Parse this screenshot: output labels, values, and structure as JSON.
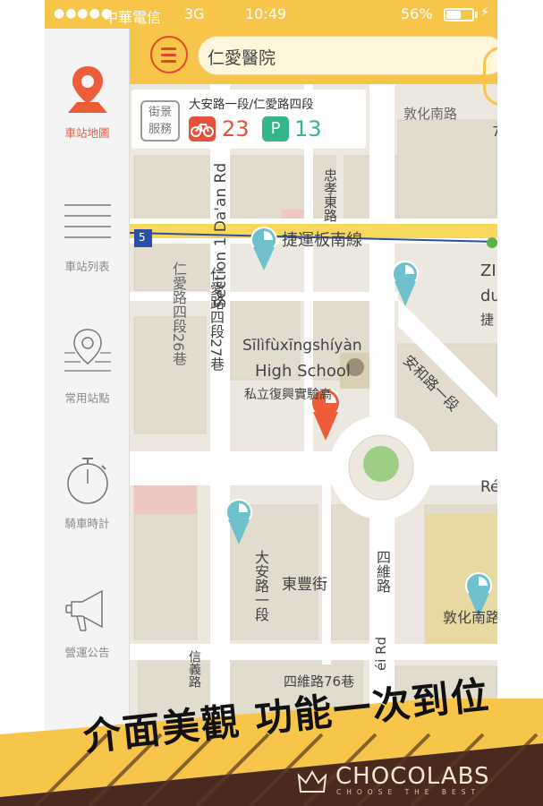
{
  "status_bar": {
    "signal": "●●●●●",
    "carrier": "中華電信",
    "network": "3G",
    "time": "10:49",
    "battery": "56%",
    "battery_level": 0.56
  },
  "search": {
    "value": "仁愛醫院"
  },
  "sidebar": {
    "items": [
      {
        "label": "車站地圖",
        "icon": "map-pin-icon",
        "active": true
      },
      {
        "label": "車站列表",
        "icon": "list-icon",
        "active": false
      },
      {
        "label": "常用站點",
        "icon": "favorite-pin-icon",
        "active": false
      },
      {
        "label": "騎車時計",
        "icon": "stopwatch-icon",
        "active": false
      },
      {
        "label": "營運公告",
        "icon": "megaphone-icon",
        "active": false
      }
    ]
  },
  "station_card": {
    "street_view_line1": "街景",
    "street_view_line2": "服務",
    "name": "大安路一段/仁愛路四段",
    "bikes": "23",
    "parking": "13",
    "parking_badge": "P"
  },
  "map": {
    "labels": {
      "route_no": "5",
      "metro": "捷運板南線",
      "dunhua_top": "敦化南路",
      "section1": "Section 1 Da'an Rd",
      "dunhua_right": "ZI",
      "dunhua_right2": "du",
      "dunhua_right3": "捷",
      "zhongxiao": "忠孝東路",
      "renai_vertical": "仁愛路四段27巷",
      "left_vertical": "仁愛路四段26巷",
      "school_en1": "Sīlìfùxīngshíyàn",
      "school_en2": "High School",
      "school_zh": "私立復興實驗高",
      "anhe": "安和路一段",
      "re": "Ré",
      "daan_vertical": "大安路一段",
      "dongfeng": "東豐街",
      "siwei_vertical": "四維路",
      "wei_rd": "éi Rd",
      "dunhua_bottom": "敦化南路",
      "yi_vertical": "信義路",
      "siwei_alley": "四維路76巷",
      "top_right_num": "7"
    },
    "colors": {
      "metro_line": "#2a4fa8",
      "station_teal": "#6ec1cc",
      "station_red": "#ef5c3a",
      "road": "#ffffff",
      "block": "#e9e4da",
      "park": "#9fcf87",
      "school": "#d8cfb5",
      "highlight_block": "#efc7c2"
    }
  },
  "banner": {
    "slogan": "介面美觀 功能一次到位",
    "brand": "CHOCOLABS",
    "tagline": "CHOOSE THE BEST"
  }
}
